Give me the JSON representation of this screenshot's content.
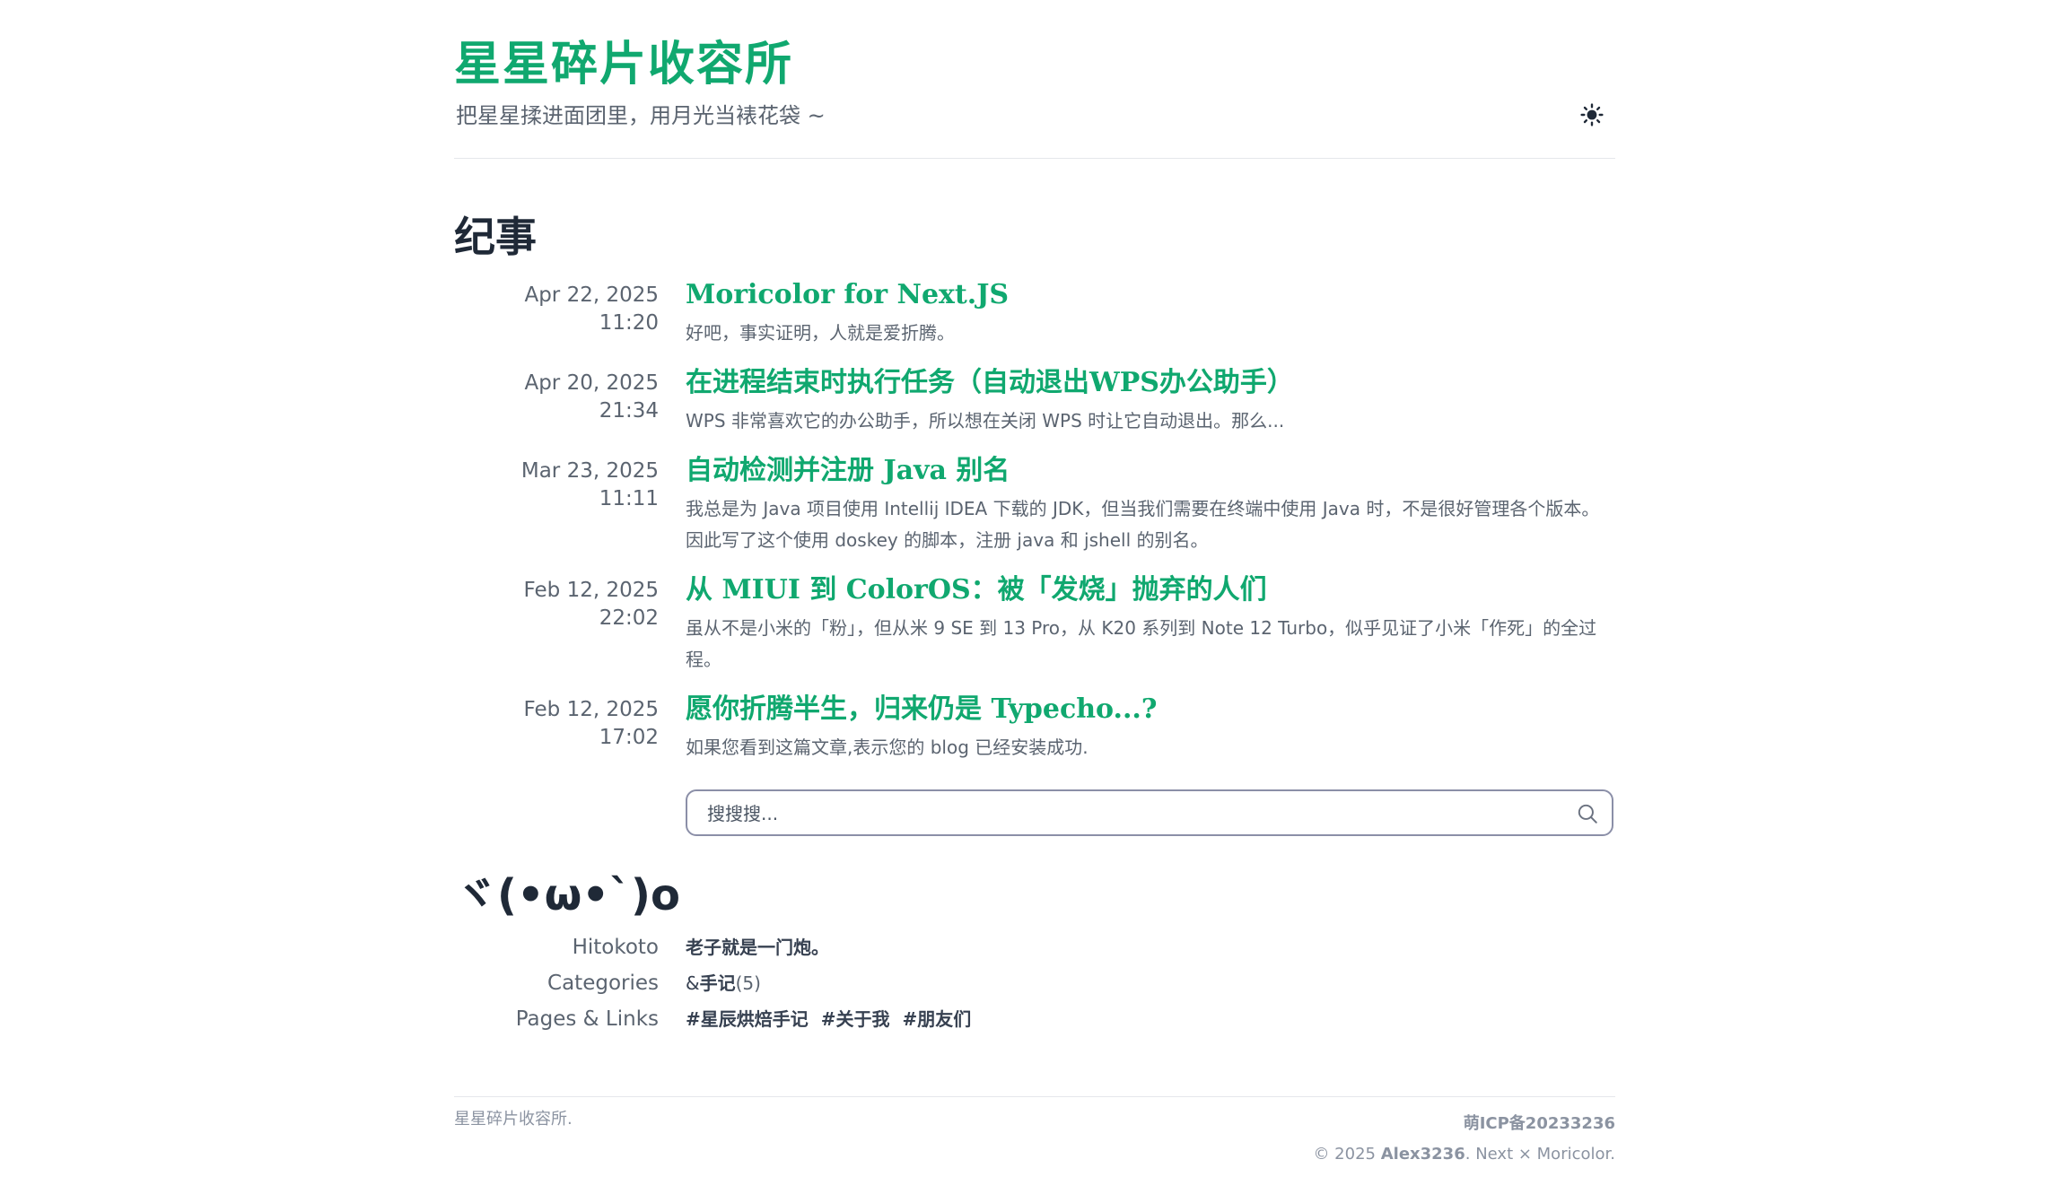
{
  "header": {
    "site_title": "星星碎片收容所",
    "subtitle": "把星星揉进面团里，用月光当裱花袋 ~",
    "theme_toggle_icon": "sun-icon"
  },
  "archive": {
    "heading": "纪事",
    "posts": [
      {
        "date": "Apr 22, 2025",
        "time": "11:20",
        "title": "Moricolor for Next.JS",
        "excerpt": "好吧，事实证明，人就是爱折腾。"
      },
      {
        "date": "Apr 20, 2025",
        "time": "21:34",
        "title": "在进程结束时执行任务（自动退出WPS办公助手）",
        "excerpt": "WPS 非常喜欢它的办公助手，所以想在关闭 WPS 时让它自动退出。那么..."
      },
      {
        "date": "Mar 23, 2025",
        "time": "11:11",
        "title": "自动检测并注册 Java 别名",
        "excerpt": "我总是为 Java 项目使用 Intellij IDEA 下载的 JDK，但当我们需要在终端中使用 Java 时，不是很好管理各个版本。因此写了这个使用 doskey 的脚本，注册 java 和 jshell 的别名。"
      },
      {
        "date": "Feb 12, 2025",
        "time": "22:02",
        "title": "从 MIUI 到 ColorOS：被「发烧」抛弃的人们",
        "excerpt": "虽从不是小米的「粉」，但从米 9 SE 到 13 Pro，从 K20 系列到 Note 12 Turbo，似乎见证了小米「作死」的全过程。"
      },
      {
        "date": "Feb 12, 2025",
        "time": "17:02",
        "title": "愿你折腾半生，归来仍是 Typecho...?",
        "excerpt": "如果您看到这篇文章,表示您的 blog 已经安装成功."
      }
    ]
  },
  "search": {
    "placeholder": "搜搜搜...",
    "icon": "search-icon"
  },
  "info": {
    "heading": "ヾ(•ω•`)o",
    "hitokoto_label": "Hitokoto",
    "hitokoto_text": "老子就是一门炮。",
    "categories_label": "Categories",
    "category_prefix": "&",
    "category_name": "手记",
    "category_count": "(5)",
    "pages_label": "Pages & Links",
    "pages": [
      "#星辰烘焙手记",
      "#关于我",
      "#朋友们"
    ]
  },
  "footer": {
    "left_text": "星星碎片收容所.",
    "icp": "萌ICP备20233236",
    "copyright_prefix": "© 2025 ",
    "author": "Alex3236",
    "copyright_suffix": ". Next × Moricolor."
  },
  "colors": {
    "accent": "#10a86f",
    "text": "#4b5563",
    "heading": "#1f2937"
  }
}
